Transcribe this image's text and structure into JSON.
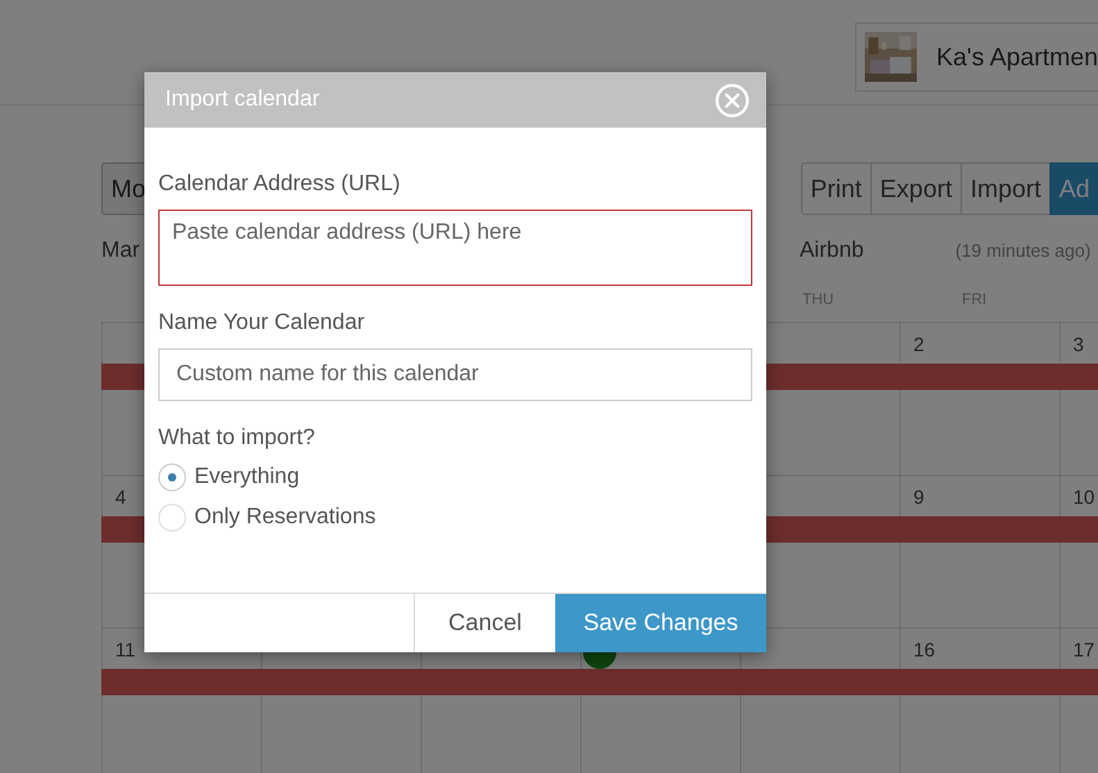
{
  "header": {
    "property": {
      "name": "Ka's Apartmen"
    }
  },
  "toolbar": {
    "view_button": "Mo",
    "actions": [
      {
        "label": "Print",
        "primary": false
      },
      {
        "label": "Export",
        "primary": false
      },
      {
        "label": "Import",
        "primary": false
      },
      {
        "label": "Ad",
        "primary": true
      }
    ]
  },
  "calendar": {
    "month_label": "Mar",
    "source": "Airbnb",
    "synced": "(19 minutes ago)",
    "weekdays": [
      "THU",
      "FRI"
    ],
    "weeks": [
      {
        "reserved": true,
        "right_days": [
          "2",
          "3"
        ]
      },
      {
        "reserved": true,
        "first_day": "4",
        "right_days": [
          "9",
          "10"
        ]
      },
      {
        "reserved": true,
        "first_day": "11",
        "marker": {
          "color": "#0e450e"
        },
        "right_days": [
          "16",
          "17"
        ]
      }
    ]
  },
  "dialog": {
    "title": "Import calendar",
    "url_field": {
      "label": "Calendar Address (URL)",
      "placeholder": "Paste calendar address (URL) here",
      "invalid": true
    },
    "name_field": {
      "label": "Name Your Calendar",
      "placeholder": "Custom name for this calendar"
    },
    "import_question": "What to import?",
    "options": [
      {
        "label": "Everything",
        "selected": true
      },
      {
        "label": "Only Reservations",
        "selected": false
      }
    ],
    "buttons": [
      {
        "label": "Cancel",
        "kind": "secondary"
      },
      {
        "label": "Save Changes",
        "kind": "primary"
      }
    ]
  }
}
